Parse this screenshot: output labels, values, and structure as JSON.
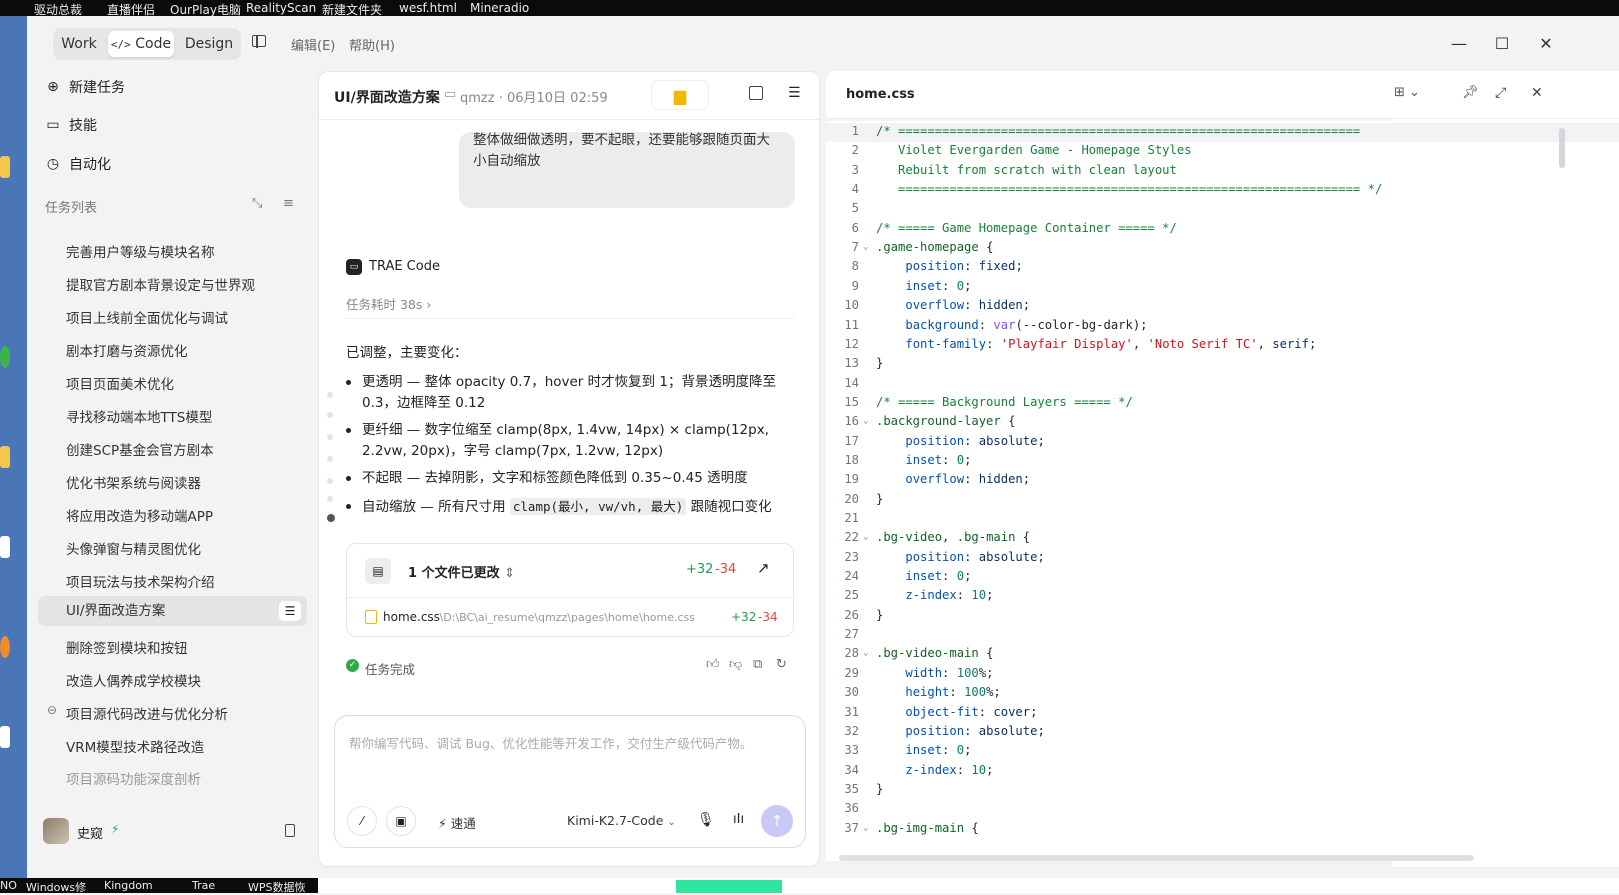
{
  "os": {
    "top_taskbar": [
      "驱动总裁",
      "直播伴侣",
      "OurPlay电脑",
      "RealityScan",
      "新建文件夹",
      "wesf.html",
      "Mineradio"
    ],
    "bottom_taskbar": [
      "NO",
      "Windows修",
      "Kingdom",
      "Trae",
      "WPS数据恢"
    ]
  },
  "titlebar": {
    "modes": [
      "Work",
      "Code",
      "Design"
    ],
    "active_mode": "Code",
    "code_mode_icon": "code-brackets-icon",
    "menus": [
      "编辑(E)",
      "帮助(H)"
    ],
    "window_controls": [
      "minimize-icon",
      "maximize-icon",
      "close-icon"
    ]
  },
  "sidebar": {
    "nav": [
      {
        "label": "新建任务",
        "icon": "plus-circle-icon"
      },
      {
        "label": "技能",
        "icon": "book-icon"
      },
      {
        "label": "自动化",
        "icon": "clock-icon"
      }
    ],
    "task_list_title": "任务列表",
    "tasks": [
      "完善用户等级与模块名称",
      "提取官方剧本背景设定与世界观",
      "项目上线前全面优化与调试",
      "剧本打磨与资源优化",
      "项目页面美术优化",
      "寻找移动端本地TTS模型",
      "创建SCP基金会官方剧本",
      "优化书架系统与阅读器",
      "将应用改造为移动端APP",
      "头像弹窗与精灵图优化",
      "项目玩法与技术架构介绍",
      "UI/界面改造方案",
      "删除签到模块和按钮",
      "改造人偶养成学校模块",
      "项目源代码改进与优化分析",
      "VRM模型技术路径改造",
      "项目源码功能深度剖析"
    ],
    "active_task": "UI/界面改造方案",
    "user_name": "史窥"
  },
  "chat": {
    "title": "UI/界面改造方案",
    "meta": "qmzz · 06月10日 02:59",
    "user_message": [
      "整体做细做透明，要不起眼，还要能够跟随页面大",
      "小自动缩放"
    ],
    "assistant_name": "TRAE Code",
    "duration": "任务耗时 38s",
    "intro": "已调整，主要变化：",
    "bullets": [
      "更透明 — 整体 opacity 0.7，hover 时才恢复到 1；背景透明度降至 0.3，边框降至 0.12",
      "更纤细 — 数字位缩至 clamp(8px, 1.4vw, 14px) × clamp(12px, 2.2vw, 20px)，字号 clamp(7px, 1.2vw, 12px)",
      "不起眼 — 去掉阴影，文字和标签颜色降低到 0.35~0.45 透明度"
    ],
    "bullet4_prefix": "自动缩放 — 所有尺寸用 ",
    "bullet4_code": "clamp(最小, vw/vh, 最大)",
    "bullet4_suffix": " 跟随视口变化",
    "files_changed": "1 个文件已更改",
    "diff_add": "+32",
    "diff_del": "-34",
    "file_name": "home.css",
    "file_path": ".\\D:\\BC\\ai_resume\\qmzz\\pages\\home\\home.css",
    "status": "任务完成",
    "input_placeholder": "帮你编写代码、调试 Bug、优化性能等开发工作，交付生产级代码产物。",
    "speed_label": "速通",
    "model": "Kimi-K2.7-Code"
  },
  "editor": {
    "filename": "home.css",
    "lines": [
      {
        "n": 1,
        "html": "<span class='c-com'>/* ===============================================================</span>"
      },
      {
        "n": 2,
        "html": "<span class='c-com'>   Violet Evergarden Game - Homepage Styles</span>"
      },
      {
        "n": 3,
        "html": "<span class='c-com'>   Rebuilt from scratch with clean layout</span>"
      },
      {
        "n": 4,
        "html": "<span class='c-com'>   =============================================================== */</span>"
      },
      {
        "n": 5,
        "html": ""
      },
      {
        "n": 6,
        "html": "<span class='c-com'>/* ===== Game Homepage Container ===== */</span>"
      },
      {
        "n": 7,
        "fold": true,
        "html": "<span class='c-sel'>.game-homepage</span> {"
      },
      {
        "n": 8,
        "html": "    <span class='c-prop'>position</span>: <span class='c-val'>fixed</span>;"
      },
      {
        "n": 9,
        "html": "    <span class='c-prop'>inset</span>: <span class='c-num'>0</span>;"
      },
      {
        "n": 10,
        "html": "    <span class='c-prop'>overflow</span>: <span class='c-val'>hidden</span>;"
      },
      {
        "n": 11,
        "html": "    <span class='c-prop'>background</span>: <span class='c-kw'>var</span>(--color-bg-dark);"
      },
      {
        "n": 12,
        "html": "    <span class='c-prop'>font-family</span>: <span class='c-str'>'Playfair Display'</span>, <span class='c-str'>'Noto Serif TC'</span>, <span class='c-val'>serif</span>;"
      },
      {
        "n": 13,
        "html": "}"
      },
      {
        "n": 14,
        "html": ""
      },
      {
        "n": 15,
        "html": "<span class='c-com'>/* ===== Background Layers ===== */</span>"
      },
      {
        "n": 16,
        "fold": true,
        "html": "<span class='c-sel'>.background-layer</span> {"
      },
      {
        "n": 17,
        "html": "    <span class='c-prop'>position</span>: <span class='c-val'>absolute</span>;"
      },
      {
        "n": 18,
        "html": "    <span class='c-prop'>inset</span>: <span class='c-num'>0</span>;"
      },
      {
        "n": 19,
        "html": "    <span class='c-prop'>overflow</span>: <span class='c-val'>hidden</span>;"
      },
      {
        "n": 20,
        "html": "}"
      },
      {
        "n": 21,
        "html": ""
      },
      {
        "n": 22,
        "fold": true,
        "html": "<span class='c-sel'>.bg-video</span>, <span class='c-sel'>.bg-main</span> {"
      },
      {
        "n": 23,
        "html": "    <span class='c-prop'>position</span>: <span class='c-val'>absolute</span>;"
      },
      {
        "n": 24,
        "html": "    <span class='c-prop'>inset</span>: <span class='c-num'>0</span>;"
      },
      {
        "n": 25,
        "html": "    <span class='c-prop'>z-index</span>: <span class='c-num'>10</span>;"
      },
      {
        "n": 26,
        "html": "}"
      },
      {
        "n": 27,
        "html": ""
      },
      {
        "n": 28,
        "fold": true,
        "html": "<span class='c-sel'>.bg-video-main</span> {"
      },
      {
        "n": 29,
        "html": "    <span class='c-prop'>width</span>: <span class='c-num'>100</span>%;"
      },
      {
        "n": 30,
        "html": "    <span class='c-prop'>height</span>: <span class='c-num'>100</span>%;"
      },
      {
        "n": 31,
        "html": "    <span class='c-prop'>object-fit</span>: <span class='c-val'>cover</span>;"
      },
      {
        "n": 32,
        "html": "    <span class='c-prop'>position</span>: <span class='c-val'>absolute</span>;"
      },
      {
        "n": 33,
        "html": "    <span class='c-prop'>inset</span>: <span class='c-num'>0</span>;"
      },
      {
        "n": 34,
        "html": "    <span class='c-prop'>z-index</span>: <span class='c-num'>10</span>;"
      },
      {
        "n": 35,
        "html": "}"
      },
      {
        "n": 36,
        "html": ""
      },
      {
        "n": 37,
        "fold": true,
        "html": "<span class='c-sel'>.bg-img-main</span> {"
      }
    ]
  },
  "colors": {
    "accent": "#8a8af0",
    "diff_add": "#1f9d55",
    "diff_del": "#e0453a",
    "success": "#2fa84f"
  }
}
